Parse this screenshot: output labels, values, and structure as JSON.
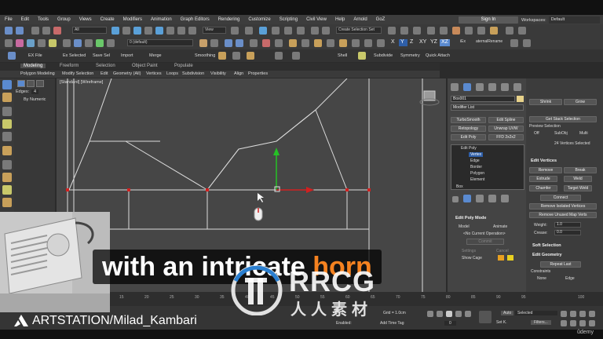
{
  "menu": {
    "items": [
      "File",
      "Edit",
      "Tools",
      "Group",
      "Views",
      "Create",
      "Modifiers",
      "Animation",
      "Graph Editors",
      "Rendering",
      "Customize",
      "Scripting",
      "Civil View",
      "Help",
      "Arnold",
      "GoZ"
    ],
    "signin": "Sign In",
    "workspace_label": "Workspaces:",
    "workspace_value": "Default"
  },
  "toolbar": {
    "filter_select": "All",
    "view_select": "View",
    "selection_set": "Create Selection Set",
    "layer_select": "0 (default)",
    "axis_labels": [
      "X",
      "Y",
      "Z",
      "XY",
      "YZ",
      "XZ"
    ],
    "external_rename": "aternalRename",
    "ex_label": "iEx",
    "row3": [
      "EX File",
      "Ex Selected",
      "Save Sel",
      "Import",
      "Merge",
      "Smoothing",
      "Shell",
      "Subdivide",
      "Symmetry",
      "Quick Attach"
    ]
  },
  "ribbon": {
    "tabs": [
      "Modeling",
      "Freeform",
      "Selection",
      "Object Paint",
      "Populate"
    ],
    "active_tab": "Modeling",
    "row": [
      "Polygon Modeling",
      "Modify Selection",
      "Edit",
      "Geometry (All)",
      "Vertices",
      "Loops",
      "Subdivision",
      "Visibility",
      "Align",
      "Properties"
    ]
  },
  "leftpanel": {
    "edges_label": "Edges:",
    "edges_value": "4",
    "by_numeric": "By Numeric"
  },
  "viewport": {
    "label": "[Standard] [Wireframe]"
  },
  "command_panel": {
    "object_name": "Box001",
    "modifier_list": "Modifier List",
    "buttons": [
      "TurboSmooth",
      "Edit Spline",
      "Retopology",
      "Unwrap UVW",
      "Edit Poly",
      "FFD 2x2x2"
    ],
    "stack": [
      "Edit Poly",
      "Vertex",
      "Edge",
      "Border",
      "Polygon",
      "Element",
      "Box"
    ],
    "stack_selected": "Vertex",
    "edit_poly_mode": "Edit Poly Mode",
    "mode_model": "Model",
    "mode_animate": "Animate",
    "no_current_op": "<No Current Operation>",
    "commit": "Commit",
    "settings": "Settings",
    "cancel": "Cancel",
    "show_cage": "Show Cage"
  },
  "right_panel": {
    "shrink": "Shrink",
    "grow": "Grow",
    "get_stack_selection": "Get Stack Selection",
    "preview_selection": "Preview Selection",
    "off": "Off",
    "subobj": "SubObj",
    "multi": "Multi",
    "vertices_selected": "24 Vertices Selected",
    "edit_vertices": "Edit Vertices",
    "remove": "Remove",
    "break": "Break",
    "extrude": "Extrude",
    "weld": "Weld",
    "chamfer": "Chamfer",
    "target_weld": "Target Weld",
    "connect": "Connect",
    "remove_isolated": "Remove Isolated Vertices",
    "remove_unused": "Remove Unused Map Verts",
    "weight_label": "Weight:",
    "weight_value": "1.0",
    "crease_label": "Crease:",
    "crease_value": "0.0",
    "soft_selection": "Soft Selection",
    "edit_geometry": "Edit Geometry",
    "repeat_last": "Repeat Last",
    "constraints": "Constraints",
    "none": "None",
    "edge": "Edge"
  },
  "timeline": {
    "ticks": [
      "15",
      "20",
      "25",
      "30",
      "35",
      "40",
      "45",
      "50",
      "55",
      "60",
      "65",
      "70",
      "75",
      "80",
      "85",
      "90",
      "95",
      "100"
    ]
  },
  "statusbar": {
    "grid": "Grid = 1.0cm",
    "enabled": "Enabled:",
    "add_time_tag": "Add Time Tag",
    "auto": "Auto",
    "selected": "Selected",
    "set_k": "Set K.",
    "filters": "Filters...",
    "frame": "0"
  },
  "overlay": {
    "subtitle_pre": "with an intricate ",
    "subtitle_hl": "horn",
    "watermark": "RRCG",
    "watermark_cn": "人人素材",
    "artstation": "ARTSTATION/Milad_Kambari",
    "udemy": "ûdemy"
  },
  "colors": {
    "accent_blue": "#2f5fa8",
    "subtitle_highlight": "#f58220",
    "vertex_red": "#d02020",
    "gizmo_green": "#25c025"
  }
}
